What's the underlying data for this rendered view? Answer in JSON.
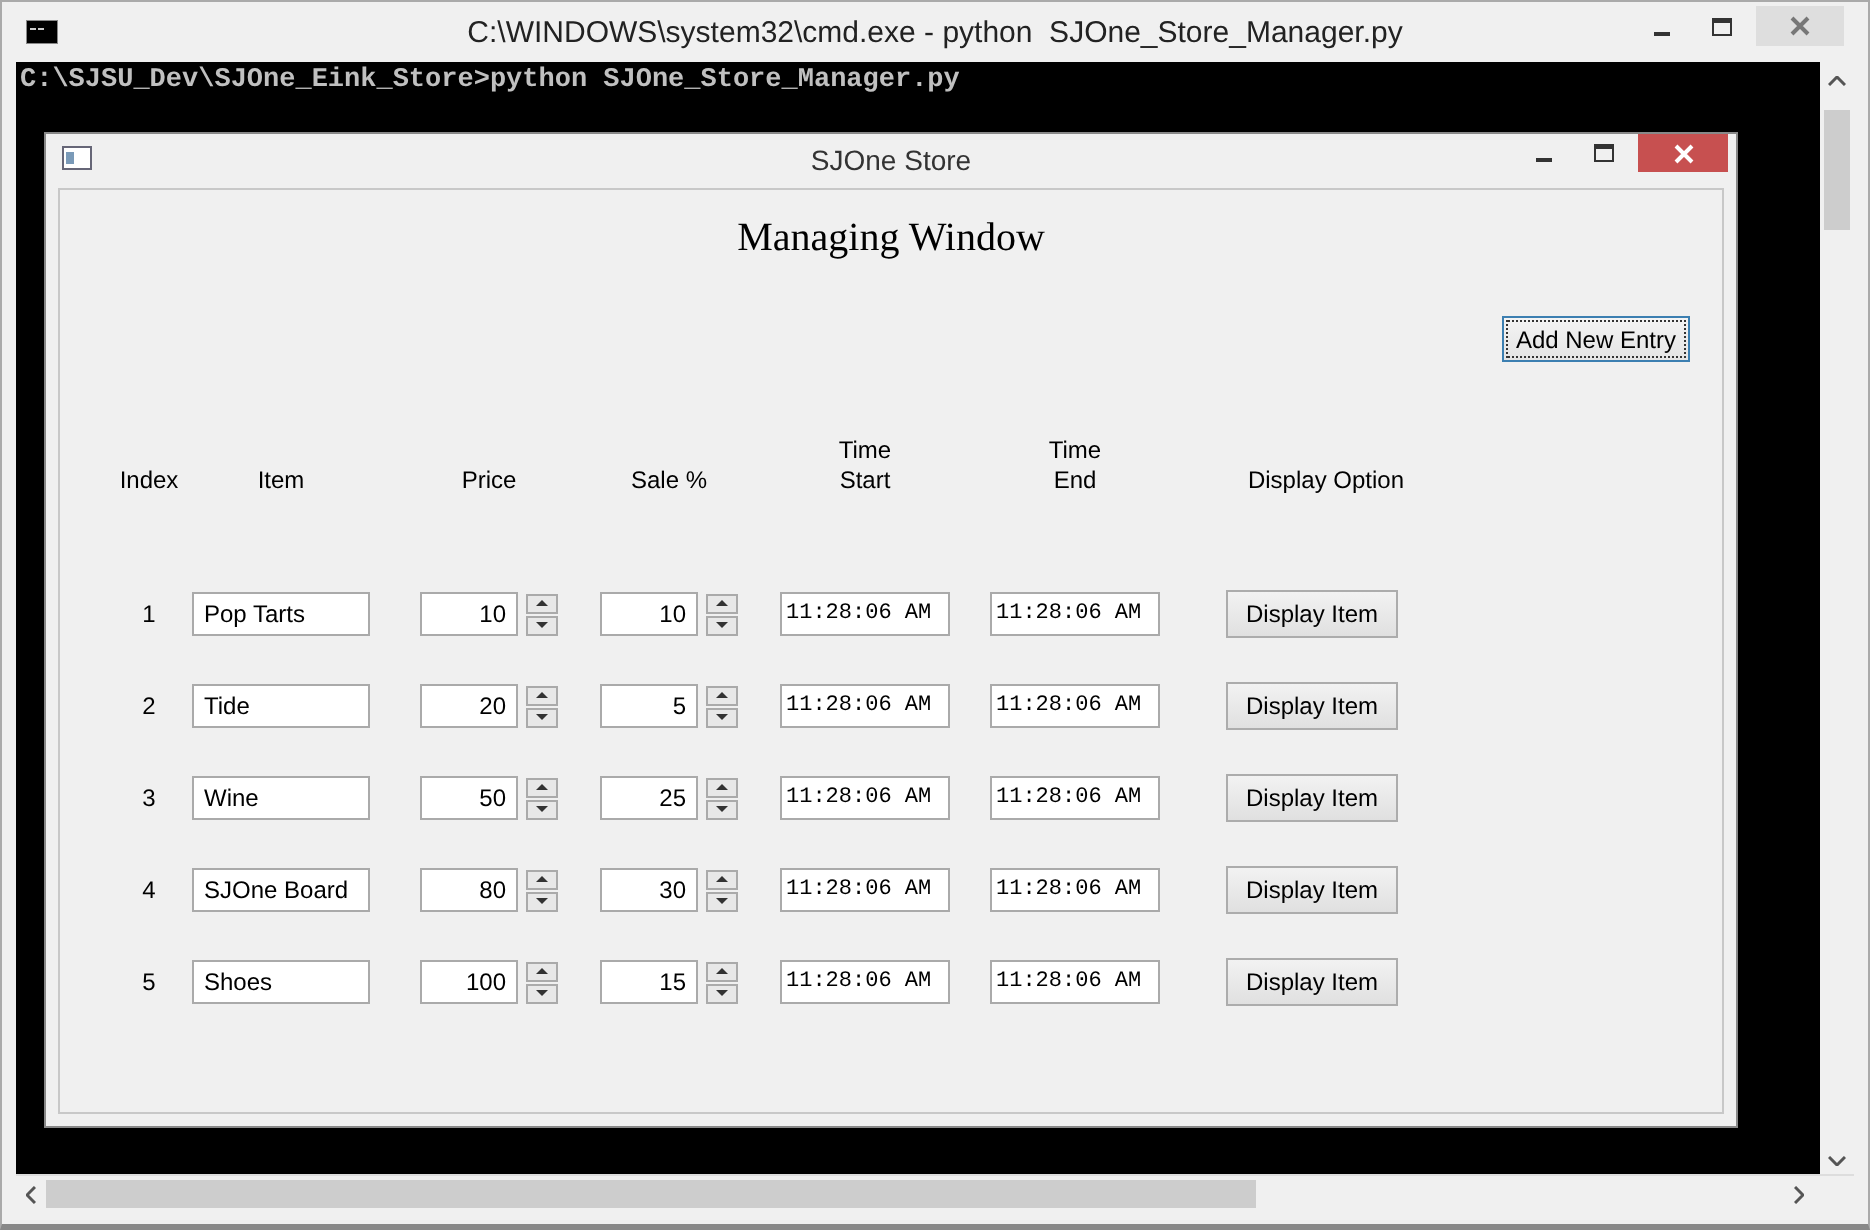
{
  "console_window": {
    "title": "C:\\WINDOWS\\system32\\cmd.exe - python  SJOne_Store_Manager.py",
    "lines": [
      "C:\\SJSU_Dev\\SJOne_Eink_Store>python SJOne_Store_Manager.py"
    ]
  },
  "app_window": {
    "title": "SJOne Store",
    "heading": "Managing Window",
    "add_button": {
      "label": "Add New Entry",
      "focused": true
    },
    "columns": [
      "Index",
      "Item",
      "Price",
      "Sale %",
      "Time\nStart",
      "Time\nEnd",
      "Display Option"
    ],
    "rows": [
      {
        "index": "1",
        "item": "Pop Tarts",
        "price": "10",
        "sale": "10",
        "time_start": "11:28:06 AM",
        "time_end": "11:28:06 AM",
        "action": "Display Item"
      },
      {
        "index": "2",
        "item": "Tide",
        "price": "20",
        "sale": "5",
        "time_start": "11:28:06 AM",
        "time_end": "11:28:06 AM",
        "action": "Display Item"
      },
      {
        "index": "3",
        "item": "Wine",
        "price": "50",
        "sale": "25",
        "time_start": "11:28:06 AM",
        "time_end": "11:28:06 AM",
        "action": "Display Item"
      },
      {
        "index": "4",
        "item": "SJOne Board",
        "price": "80",
        "sale": "30",
        "time_start": "11:28:06 AM",
        "time_end": "11:28:06 AM",
        "action": "Display Item"
      },
      {
        "index": "5",
        "item": "Shoes",
        "price": "100",
        "sale": "15",
        "time_start": "11:28:06 AM",
        "time_end": "11:28:06 AM",
        "action": "Display Item"
      }
    ]
  }
}
